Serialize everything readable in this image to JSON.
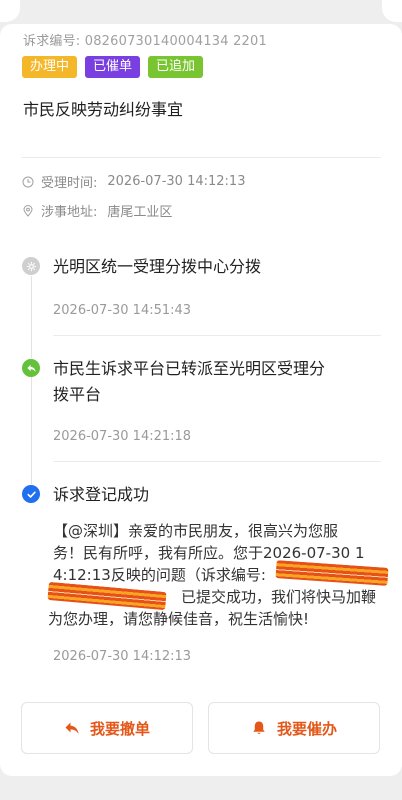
{
  "case": {
    "number_label": "诉求编号:",
    "number_value": "08260730140004134 2201",
    "tags": [
      "办理中",
      "已催单",
      "已追加"
    ],
    "title": "市民反映劳动纠纷事宜",
    "accept_time_label": "受理时间:",
    "accept_time_value": "2026-07-30 14:12:13",
    "address_label": "涉事地址:",
    "address_value": "唐尾工业区"
  },
  "timeline": [
    {
      "icon": "gear-icon",
      "title_line1": "光明区统一受理分拨中心分拨",
      "time": "2026-07-30 14:51:43"
    },
    {
      "icon": "reply-icon",
      "title_line1": "市民生诉求平台已转派至光明区受理分",
      "title_line2": "拨平台",
      "time": "2026-07-30 14:21:18"
    },
    {
      "icon": "check-icon",
      "title_line1": "诉求登记成功",
      "body_line1": "【@深圳】亲爱的市民朋友，很高兴为您服",
      "body_line2": "务！民有所呼，我有所应。您于2026-07-30 1",
      "body_line3": "4:12:13反映的问题（诉求编号:",
      "body_line4": "已提交成功，我们将快马加鞭",
      "body_line5": "为您办理，请您静候佳音，祝生活愉快!",
      "time": "2026-07-30 14:12:13"
    }
  ],
  "actions": {
    "withdraw_label": "我要撤单",
    "urge_label": "我要催办"
  },
  "colors": {
    "accent": "#e45719",
    "tag_processing": "#f5b72a",
    "tag_urged": "#7a3fe0",
    "tag_added": "#79c531",
    "check_blue": "#1f6ff0",
    "reply_green": "#63c23a"
  }
}
